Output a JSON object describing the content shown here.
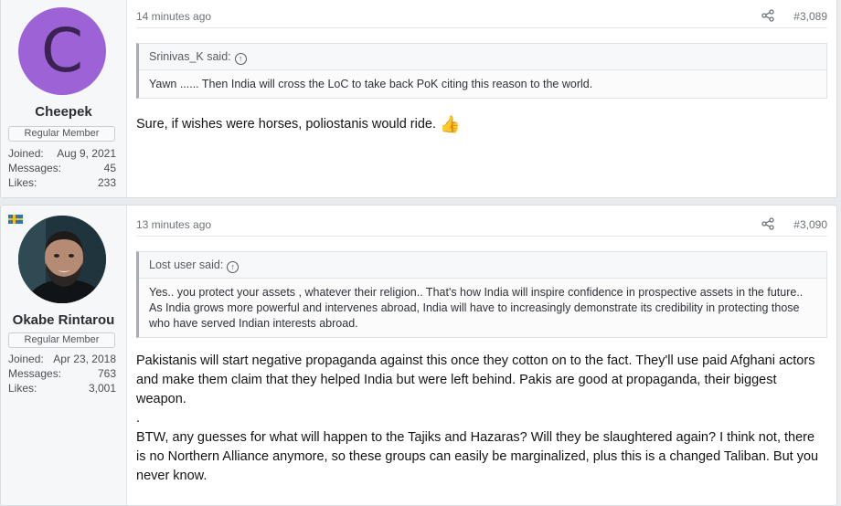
{
  "posts": [
    {
      "avatar_letter": "C",
      "avatar_color": "#9d63d6",
      "username": "Cheepek",
      "role": "Regular Member",
      "stats": [
        {
          "label": "Joined:",
          "value": "Aug 9, 2021"
        },
        {
          "label": "Messages:",
          "value": "45"
        },
        {
          "label": "Likes:",
          "value": "233"
        }
      ],
      "time": "14 minutes ago",
      "post_number": "#3,089",
      "quote_author": "Srinivas_K said:",
      "quote_text": "Yawn ...... Then India will cross the LoC to take back PoK citing this reason to the world.",
      "body": "Sure, if wishes were horses, poliostanis would ride.",
      "body_emoji": "👍"
    },
    {
      "flag": "Sweden",
      "username": "Okabe Rintarou",
      "role": "Regular Member",
      "stats": [
        {
          "label": "Joined:",
          "value": "Apr 23, 2018"
        },
        {
          "label": "Messages:",
          "value": "763"
        },
        {
          "label": "Likes:",
          "value": "3,001"
        }
      ],
      "time": "13 minutes ago",
      "post_number": "#3,090",
      "quote_author": "Lost user said:",
      "quote_text": "Yes.. you protect your assets , whatever their religion.. That's how India will inspire confidence in prospective assets in the future.. As India grows more powerful and intervenes abroad, India will have to increasingly demonstrate its credibility in protecting those who have served Indian interests abroad.",
      "body_paragraphs": [
        "Pakistanis will start negative propaganda against this once they cotton on to the fact. They'll use paid Afghani actors and make them claim that they helped India but were left behind. Pakis are good at propaganda, their biggest weapon.",
        ".",
        "BTW, any guesses for what will happen to the Tajiks and Hazaras? Will they be slaughtered again? I think not, there is no Northern Alliance anymore, so these groups can easily be marginalized, plus this is a changed Taliban. But you never know."
      ]
    }
  ],
  "icons": {
    "share": "share-icon",
    "quote_up": "arrow-up-circle-icon",
    "thumb": "thumbs-up-emoji"
  }
}
